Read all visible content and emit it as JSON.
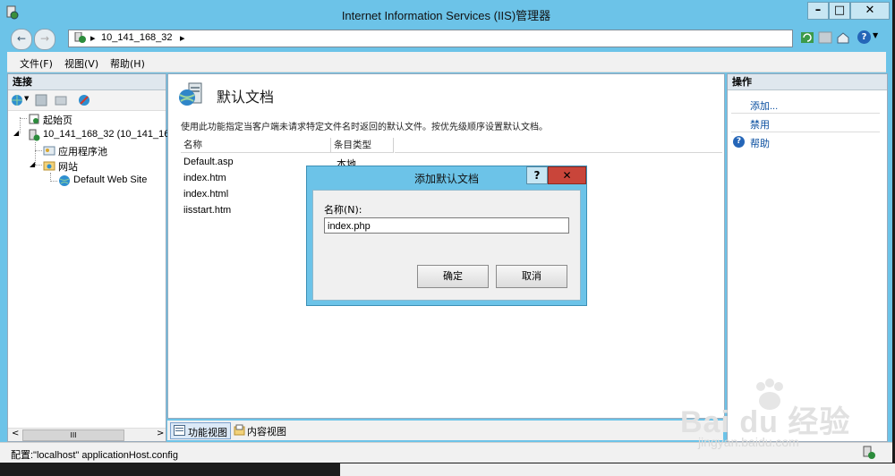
{
  "window": {
    "title": "Internet Information Services (IIS)管理器",
    "controls": {
      "minimize": "–",
      "maximize": "□",
      "close": "✕"
    }
  },
  "navbar": {
    "back": "←",
    "forward": "→",
    "breadcrumb": [
      "10_141_168_32"
    ],
    "separator": "▸",
    "help_icon": "?"
  },
  "menu": {
    "file": "文件(F)",
    "view": "视图(V)",
    "help": "帮助(H)"
  },
  "connections": {
    "header": "连接",
    "tree": [
      {
        "label": "起始页"
      },
      {
        "label": "10_141_168_32 (10_141_168"
      },
      {
        "label": "应用程序池"
      },
      {
        "label": "网站"
      },
      {
        "label": "Default Web Site"
      }
    ],
    "scroll_left": "<",
    "scroll_thumb": "III",
    "scroll_right": ">"
  },
  "center": {
    "title": "默认文档",
    "description": "使用此功能指定当客户端未请求特定文件名时返回的默认文件。按优先级顺序设置默认文档。",
    "columns": [
      "名称",
      "条目类型"
    ],
    "rows": [
      {
        "name": "Default.asp",
        "type": "本地"
      },
      {
        "name": "index.htm",
        "type": ""
      },
      {
        "name": "index.html",
        "type": ""
      },
      {
        "name": "iisstart.htm",
        "type": ""
      }
    ]
  },
  "bottom_tabs": {
    "features": "功能视图",
    "content": "内容视图"
  },
  "actions": {
    "header": "操作",
    "items": [
      {
        "label": "添加..."
      },
      {
        "label": "禁用"
      },
      {
        "label": "帮助"
      }
    ]
  },
  "status": {
    "text": "配置:\"localhost\" applicationHost.config"
  },
  "dialog": {
    "title": "添加默认文档",
    "help": "?",
    "close": "✕",
    "field_label": "名称(N):",
    "field_value": "index.php",
    "ok": "确定",
    "cancel": "取消"
  },
  "watermark": {
    "brand": "Bai du 经验",
    "url": "jingyan.baidu.com"
  },
  "colors": {
    "titlebar": "#6cc3e8",
    "close_button": "#c9453a",
    "link": "#0a4fa0"
  }
}
